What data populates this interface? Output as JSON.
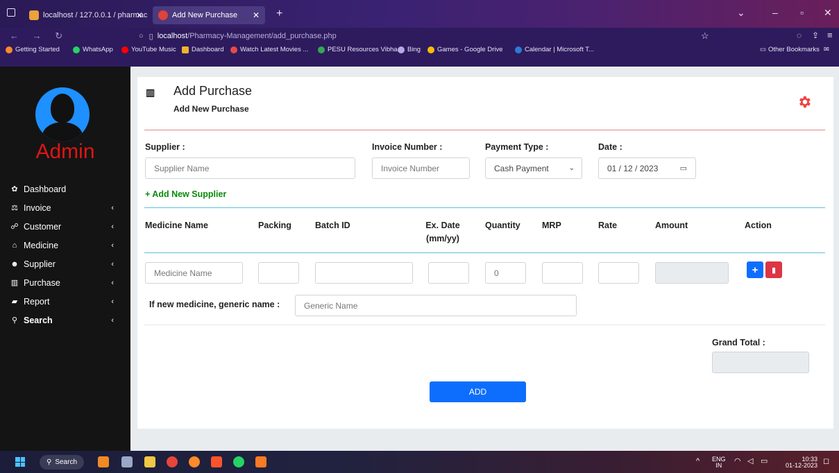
{
  "browser": {
    "tabs": [
      {
        "label": "localhost / 127.0.0.1 / pharmac",
        "active": false
      },
      {
        "label": "Add New Purchase",
        "active": true
      }
    ],
    "url_host": "localhost",
    "url_path": "/Pharmacy-Management/add_purchase.php",
    "bookmarks": [
      "Getting Started",
      "WhatsApp",
      "YouTube Music",
      "Dashboard",
      "Watch Latest Movies ...",
      "PESU Resources Vibha...",
      "Bing",
      "Games - Google Drive",
      "Calendar | Microsoft T..."
    ],
    "other_bookmarks": "Other Bookmarks"
  },
  "sidebar": {
    "user": "Admin",
    "items": [
      {
        "label": "Dashboard",
        "icon": "palette-icon"
      },
      {
        "label": "Invoice",
        "icon": "scale-icon"
      },
      {
        "label": "Customer",
        "icon": "handshake-icon"
      },
      {
        "label": "Medicine",
        "icon": "shop-icon"
      },
      {
        "label": "Supplier",
        "icon": "users-icon"
      },
      {
        "label": "Purchase",
        "icon": "bar-chart-icon"
      },
      {
        "label": "Report",
        "icon": "book-icon"
      },
      {
        "label": "Search",
        "icon": "search-icon"
      }
    ]
  },
  "page": {
    "title": "Add Purchase",
    "subtitle": "Add New Purchase"
  },
  "form": {
    "supplier_label": "Supplier :",
    "supplier_placeholder": "Supplier Name",
    "invoice_label": "Invoice Number :",
    "invoice_placeholder": "Invoice Number",
    "payment_label": "Payment Type :",
    "payment_value": "Cash Payment",
    "date_label": "Date :",
    "date_value": "01 / 12 / 2023",
    "add_supplier": "+ Add New Supplier"
  },
  "table": {
    "headers": [
      "Medicine Name",
      "Packing",
      "Batch ID",
      "Ex. Date (mm/yy)",
      "Quantity",
      "MRP",
      "Rate",
      "Amount",
      "Action"
    ],
    "row": {
      "medicine_placeholder": "Medicine Name",
      "quantity_value": "0"
    },
    "generic_label": "If new medicine, generic name :",
    "generic_placeholder": "Generic Name"
  },
  "totals": {
    "grand_total_label": "Grand Total :",
    "add_button": "ADD"
  },
  "taskbar": {
    "search": "Search",
    "lang": "ENG",
    "region": "IN",
    "time": "10:33",
    "date": "01-12-2023"
  },
  "colors": {
    "accent": "#0d6efd",
    "danger": "#dc3545",
    "admin": "#e01515",
    "sidebar_bg": "#141414"
  }
}
